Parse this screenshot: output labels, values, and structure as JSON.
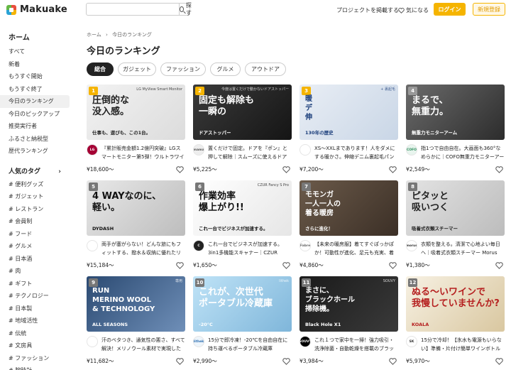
{
  "header": {
    "logo_text": "Makuake",
    "search_placeholder": "",
    "search_button": "探す",
    "post_project": "プロジェクトを掲載する",
    "watchlist": "気になる",
    "login": "ログイン",
    "signup": "新規登録",
    "accent_color": "#f5b400"
  },
  "sidebar": {
    "home_heading": "ホーム",
    "items": [
      "すべて",
      "新着",
      "もうすぐ開始",
      "もうすぐ終了",
      "今日のランキング",
      "今日のピックアップ",
      "推奨実行者",
      "ふるさと納税型",
      "歴代ランキング"
    ],
    "active_index": 4,
    "tags_heading": "人気のタグ",
    "tags": [
      "# 便利グッズ",
      "# ガジェット",
      "# レストラン",
      "# 会員制",
      "# フード",
      "# グルメ",
      "# 日本酒",
      "# 肉",
      "# ギフト",
      "# テクノロジー",
      "# 日本製",
      "# 地域活性",
      "# 伝統",
      "# 文房具",
      "# ファッション",
      "# 腕時計"
    ]
  },
  "breadcrumb": {
    "home": "ホーム",
    "sep": "›",
    "current": "今日のランキング"
  },
  "page_title": "今日のランキング",
  "tabs": [
    "総合",
    "ガジェット",
    "ファッション",
    "グルメ",
    "アウトドア"
  ],
  "active_tab": 0,
  "cards": [
    {
      "rank": "1",
      "title": "『累計販売金額1.2億円突破』LGスマートモニター第5弾！ウルトラワイドモニター",
      "price": "¥18,600〜",
      "brand": "LG",
      "thumb_lines": [
        "圧倒的な",
        "没入感。"
      ],
      "thumb_sub": "仕事も、遊びも、この1台。",
      "thumb_brand": "LG MyView Smart Monitor"
    },
    {
      "rank": "2",
      "title": "置くだけで固定。ドアを『ポン』と押して解除｜スムーズに使えるドアストッパー",
      "price": "¥5,225〜",
      "brand": "mama",
      "thumb_lines": [
        "固定も解除も",
        "一瞬の"
      ],
      "thumb_sub": "ドアストッパー",
      "thumb_brand": "今度は置くだけで動かないドアストッパー"
    },
    {
      "rank": "3",
      "title": "XS〜XXLまであります！人をダメにする暖かさ。伸縮デニム裏起毛パンツ",
      "price": "¥7,200〜",
      "brand": "",
      "thumb_lines": [
        "暖",
        "デ",
        "伸"
      ],
      "thumb_sub": "130年の歴史",
      "thumb_brand": "+ 裏起毛"
    },
    {
      "rank": "4",
      "title": "指1つで自由自在。大画面も360°なめらかに｜COFO無重力モニターアーム",
      "price": "¥2,549〜",
      "brand": "COFO",
      "thumb_lines": [
        "まるで、",
        "無重力。"
      ],
      "thumb_sub": "無重力モニターアーム",
      "thumb_brand": ""
    },
    {
      "rank": "5",
      "title": "両手が塞がらない！どんな旅にもフィットする、撥水＆収納に優れたリュック",
      "price": "¥15,184〜",
      "brand": "",
      "thumb_lines": [
        "4 WAYなのに、",
        "軽い。"
      ],
      "thumb_sub": "DYDASH",
      "thumb_brand": ""
    },
    {
      "rank": "6",
      "title": "これ一台でビジネスが加速する。3in1多機能スキャナー｜CZUR",
      "price": "¥1,650〜",
      "brand": "C",
      "thumb_lines": [
        "作業効率",
        "爆上がり!!"
      ],
      "thumb_sub": "これ一台でビジネスが加速する。",
      "thumb_brand": "CZUR Fancy S Pro"
    },
    {
      "rank": "7",
      "title": "【未来の暖房服】着てすぐぽっかぽか！可動性が進化、足元も充実、着る暖房",
      "price": "¥4,860〜",
      "brand": "Fabre",
      "thumb_lines": [
        "モモンガ",
        "一人一人の",
        "着る暖房"
      ],
      "thumb_sub": "さらに進化！",
      "thumb_brand": ""
    },
    {
      "rank": "8",
      "title": "衣類を整える。清潔で心地よい毎日へ｜吸着式衣類スチーマー Morus",
      "price": "¥1,380〜",
      "brand": "morus",
      "thumb_lines": [
        "ピタッと",
        "吸いつく"
      ],
      "thumb_sub": "吸着式衣類スチーマー",
      "thumb_brand": ""
    },
    {
      "rank": "9",
      "title": "汗のベタつき、通気性の悪さ、すべて解決！メリノウール素材で実現したランニングウェア",
      "price": "¥11,682〜",
      "brand": "",
      "thumb_lines": [
        "RUN",
        "MERINO WOOL",
        "& TECHNOLOGY"
      ],
      "thumb_sub": "ALL SEASONS",
      "thumb_brand": "専用"
    },
    {
      "rank": "10",
      "title": "15分で即冷凍！-20℃を自由自在に持ち運べるポータブル冷蔵庫",
      "price": "¥2,990〜",
      "brand": "lithek",
      "thumb_lines": [
        "これが、次世代",
        "ポータブル冷蔵庫"
      ],
      "thumb_sub": "-20°C",
      "thumb_brand": "lithek"
    },
    {
      "rank": "11",
      "title": "これ１つで家中を一掃！強力吸引・洗浄除菌・自動乾燥を搭載のブラックホール",
      "price": "¥3,984〜",
      "brand": "SOUVY",
      "thumb_lines": [
        "まさに、",
        "ブラックホール",
        "掃除機。"
      ],
      "thumb_sub": "Black Hole X1",
      "thumb_brand": "SOUVY"
    },
    {
      "rank": "12",
      "title": "15分で冷却！【氷水も電源もいらない】準備・片付け簡単ワインボトルクーラー",
      "price": "¥5,970〜",
      "brand": "SK",
      "thumb_lines": [
        "ぬる〜いワインで",
        "我慢していませんか?"
      ],
      "thumb_sub": "KOALA",
      "thumb_brand": ""
    }
  ]
}
